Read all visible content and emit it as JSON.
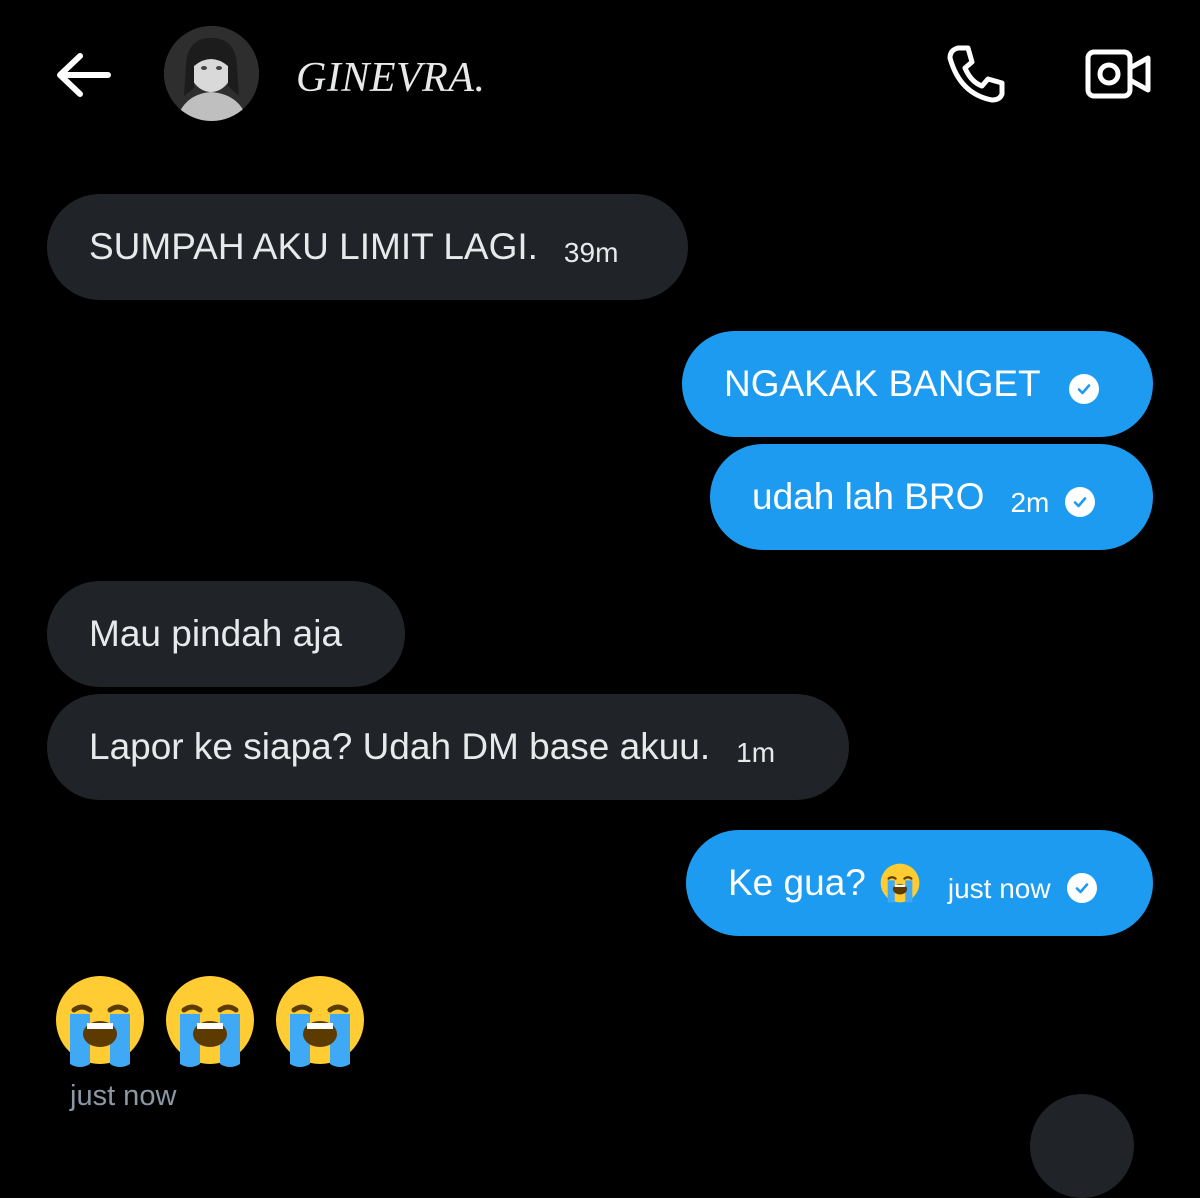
{
  "header": {
    "title": "GINEVRA.",
    "back_icon": "arrow-left-icon",
    "call_icon": "phone-icon",
    "video_icon": "video-camera-icon"
  },
  "messages": [
    {
      "direction": "incoming",
      "text": "SUMPAH AKU LIMIT LAGI.",
      "time": "39m"
    },
    {
      "direction": "outgoing",
      "text": "NGAKAK BANGET",
      "time": "",
      "read": true
    },
    {
      "direction": "outgoing",
      "text": "udah lah BRO",
      "time": "2m",
      "read": true
    },
    {
      "direction": "incoming",
      "text": "Mau pindah aja",
      "time": ""
    },
    {
      "direction": "incoming",
      "text": "Lapor ke siapa? Udah DM base akuu.",
      "time": "1m"
    },
    {
      "direction": "outgoing",
      "text": "Ke gua?",
      "emoji": "😭",
      "time": "just now",
      "read": true
    }
  ],
  "emoji_message": {
    "emojis": [
      "😭",
      "😭",
      "😭"
    ],
    "time": "just now"
  },
  "colors": {
    "background": "#000000",
    "incoming_bubble": "#202327",
    "outgoing_bubble": "#1d9bf0",
    "text": "#e7e9ea",
    "muted_text": "#8b98a5"
  }
}
